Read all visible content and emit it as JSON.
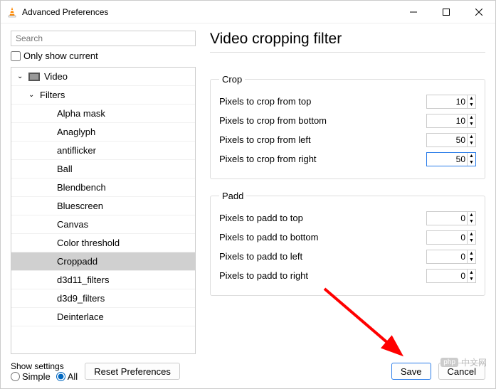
{
  "window": {
    "title": "Advanced Preferences"
  },
  "sidebar": {
    "search_placeholder": "Search",
    "only_show_current_label": "Only show current",
    "items": [
      {
        "label": "Video",
        "level": 0,
        "icon": "video"
      },
      {
        "label": "Filters",
        "level": 1
      },
      {
        "label": "Alpha mask",
        "level": 2
      },
      {
        "label": "Anaglyph",
        "level": 2
      },
      {
        "label": "antiflicker",
        "level": 2
      },
      {
        "label": "Ball",
        "level": 2
      },
      {
        "label": "Blendbench",
        "level": 2
      },
      {
        "label": "Bluescreen",
        "level": 2
      },
      {
        "label": "Canvas",
        "level": 2
      },
      {
        "label": "Color threshold",
        "level": 2
      },
      {
        "label": "Croppadd",
        "level": 2,
        "selected": true
      },
      {
        "label": "d3d11_filters",
        "level": 2
      },
      {
        "label": "d3d9_filters",
        "level": 2
      },
      {
        "label": "Deinterlace",
        "level": 2
      }
    ]
  },
  "main": {
    "heading": "Video cropping filter",
    "groups": [
      {
        "legend": "Crop",
        "rows": [
          {
            "label": "Pixels to crop from top",
            "value": "10"
          },
          {
            "label": "Pixels to crop from bottom",
            "value": "10"
          },
          {
            "label": "Pixels to crop from left",
            "value": "50"
          },
          {
            "label": "Pixels to crop from right",
            "value": "50",
            "focused": true
          }
        ]
      },
      {
        "legend": "Padd",
        "rows": [
          {
            "label": "Pixels to padd to top",
            "value": "0"
          },
          {
            "label": "Pixels to padd to bottom",
            "value": "0"
          },
          {
            "label": "Pixels to padd to left",
            "value": "0"
          },
          {
            "label": "Pixels to padd to right",
            "value": "0"
          }
        ]
      }
    ]
  },
  "footer": {
    "show_settings_label": "Show settings",
    "simple_label": "Simple",
    "all_label": "All",
    "reset_label": "Reset Preferences",
    "save_label": "Save",
    "cancel_label": "Cancel"
  },
  "watermark": {
    "badge": "php",
    "text": "中文网"
  }
}
